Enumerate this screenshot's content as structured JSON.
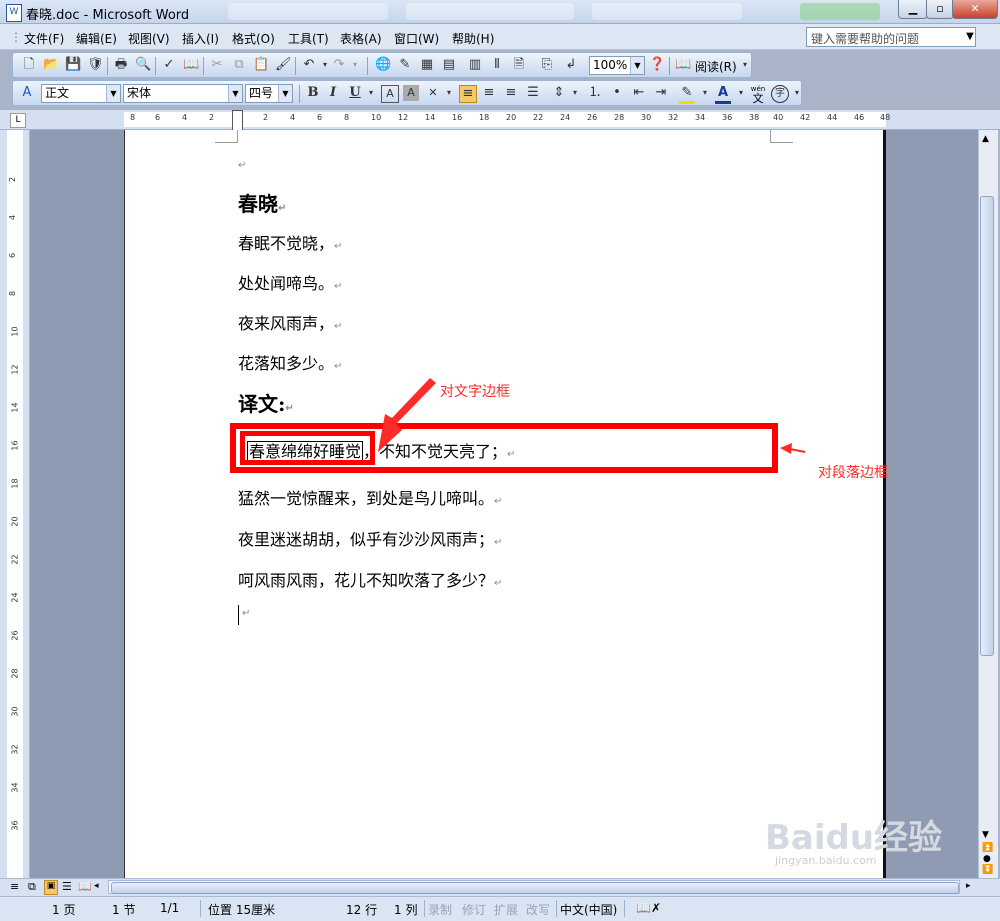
{
  "window": {
    "title": "春晓.doc - Microsoft Word",
    "app_icon": "word-doc-icon"
  },
  "menu": {
    "items": [
      "文件(F)",
      "编辑(E)",
      "视图(V)",
      "插入(I)",
      "格式(O)",
      "工具(T)",
      "表格(A)",
      "窗口(W)",
      "帮助(H)"
    ],
    "help_placeholder": "键入需要帮助的问题"
  },
  "toolbar": {
    "zoom": "100%",
    "read_label": "阅读(R)",
    "style": "正文",
    "font": "宋体",
    "size": "四号",
    "bold": "B",
    "italic": "I",
    "underline": "U",
    "phonetic_top": "wén",
    "phonetic_char": "文",
    "circle_char": "字"
  },
  "ruler": {
    "h_numbers": [
      "8",
      "6",
      "4",
      "2",
      "2",
      "4",
      "6",
      "8",
      "10",
      "12",
      "14",
      "16",
      "18",
      "20",
      "22",
      "24",
      "26",
      "28",
      "30",
      "32",
      "34",
      "36",
      "38",
      "40",
      "42",
      "44",
      "46",
      "48"
    ],
    "v_numbers": [
      "2",
      "4",
      "6",
      "8",
      "10",
      "12",
      "14",
      "16",
      "18",
      "20",
      "22",
      "24",
      "26",
      "28",
      "30",
      "32",
      "34",
      "36"
    ]
  },
  "document": {
    "title": "春晓",
    "lines": [
      "春眠不觉晓，",
      "处处闻啼鸟。",
      "夜来风雨声，",
      "花落知多少。"
    ],
    "translation_heading": "译文:",
    "bordered_text": "春意绵绵好睡觉",
    "bordered_rest": "，不知不觉天亮了；",
    "translation_lines": [
      "猛然一觉惊醒来，到处是鸟儿啼叫。",
      "夜里迷迷胡胡，似乎有沙沙风雨声；",
      "呵风雨风雨，花儿不知吹落了多少？"
    ],
    "para_mark": "↵"
  },
  "annotations": {
    "text_border": "对文字边框",
    "para_border": "对段落边框",
    "color": "#ff0000"
  },
  "status": {
    "page": "1 页",
    "section": "1 节",
    "pages": "1/1",
    "position": "位置 15厘米",
    "line": "12 行",
    "col": "1 列",
    "rec": "录制",
    "trk": "修订",
    "ext": "扩展",
    "ovr": "改写",
    "lang": "中文(中国)"
  },
  "watermark": {
    "text": "Baidu经验",
    "sub": "jingyan.baidu.com"
  }
}
